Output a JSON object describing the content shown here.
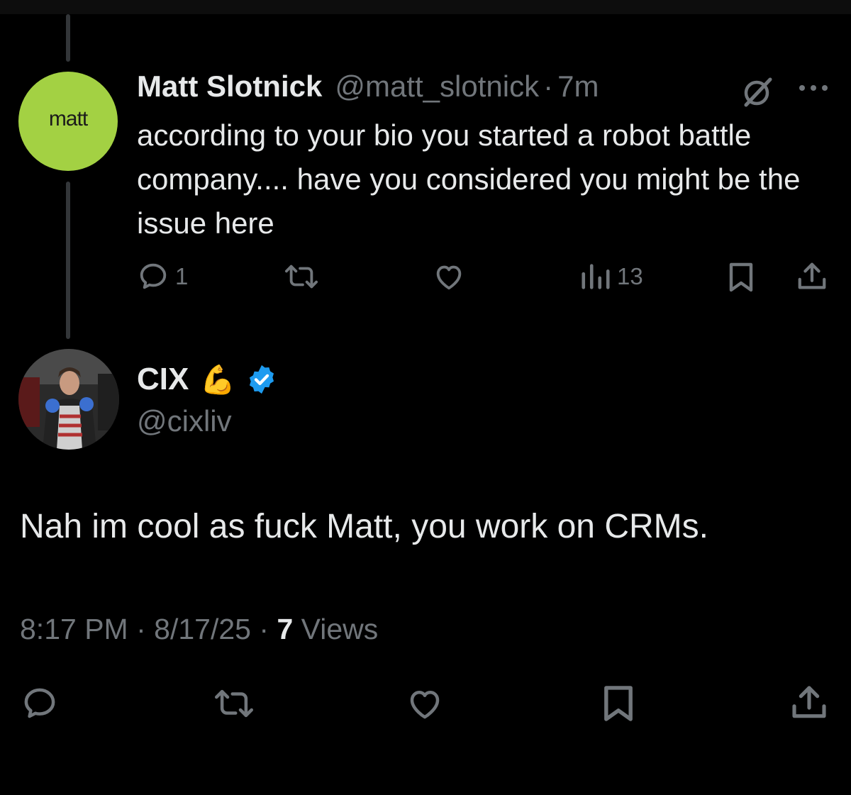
{
  "reply": {
    "avatar_text": "matt",
    "author_name": "Matt Slotnick",
    "author_handle": "@matt_slotnick",
    "separator": "·",
    "time": "7m",
    "text": "according to your bio you started a robot battle company.... have you considered you might be the issue here",
    "reply_count": "1",
    "view_count": "13",
    "header_icons": [
      "grok-icon",
      "more-icon"
    ],
    "action_icons": [
      "reply-icon",
      "retweet-icon",
      "like-icon",
      "analytics-icon",
      "bookmark-icon",
      "share-icon"
    ]
  },
  "tweet": {
    "author_name": "CIX",
    "author_emoji": "💪",
    "verified": true,
    "author_handle": "@cixliv",
    "text": "Nah im cool as fuck Matt, you work on CRMs.",
    "time": "8:17 PM",
    "separator": "·",
    "date": "8/17/25",
    "views_count": "7",
    "views_label": "Views",
    "action_icons": [
      "reply-icon",
      "retweet-icon",
      "like-icon",
      "bookmark-icon",
      "share-icon"
    ]
  },
  "colors": {
    "background": "#000000",
    "text_primary": "#e7e9ea",
    "text_secondary": "#71767b",
    "verified_badge": "#1d9bf0",
    "thread_line": "#333639",
    "matt_avatar_bg": "#a3d143"
  }
}
